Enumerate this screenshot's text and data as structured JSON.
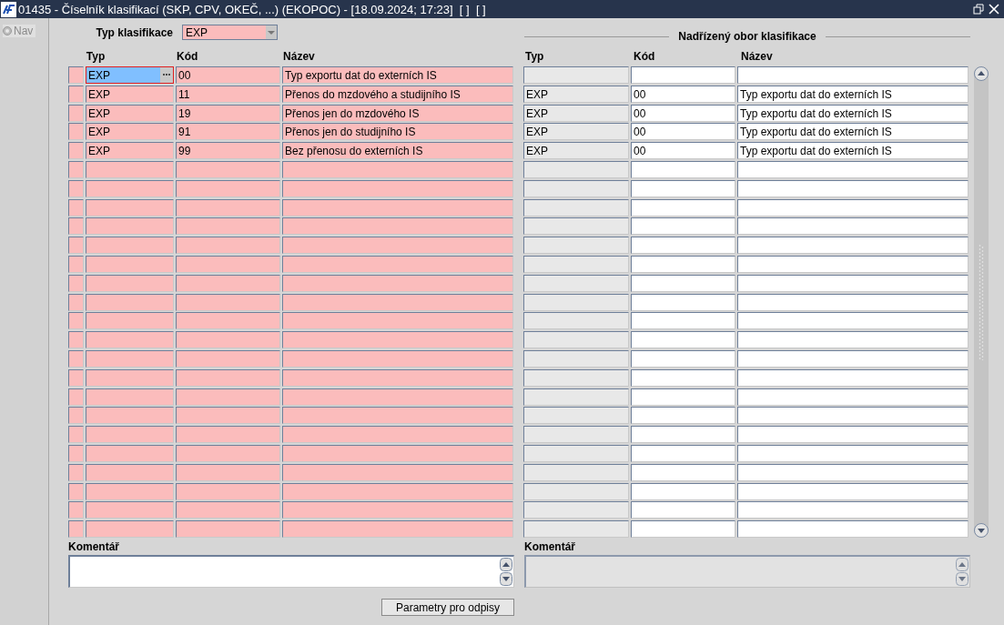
{
  "window": {
    "title": "01435 - Číselník klasifikací (SKP, CPV, OKEČ, ...) (EKOPOC) - [18.09.2024; 17:23]  [ ]  [ ]"
  },
  "nav": {
    "label": "Nav",
    "selected": false,
    "disabled": true
  },
  "filter": {
    "label": "Typ klasifikace",
    "value": "EXP"
  },
  "table": {
    "columns": [
      "Typ",
      "Kód",
      "Název"
    ],
    "rows": [
      {
        "typ": "EXP",
        "kod": "00",
        "nazev": "Typ exportu dat do externích IS",
        "selected": true
      },
      {
        "typ": "EXP",
        "kod": "11",
        "nazev": "Přenos do mzdového a studijního IS",
        "selected": false,
        "parent": {
          "typ": "EXP",
          "kod": "00",
          "nazev": "Typ exportu dat do externích IS"
        }
      },
      {
        "typ": "EXP",
        "kod": "19",
        "nazev": "Přenos jen do mzdového IS",
        "selected": false,
        "parent": {
          "typ": "EXP",
          "kod": "00",
          "nazev": "Typ exportu dat do externích IS"
        }
      },
      {
        "typ": "EXP",
        "kod": "91",
        "nazev": "Přenos jen do studijního IS",
        "selected": false,
        "parent": {
          "typ": "EXP",
          "kod": "00",
          "nazev": "Typ exportu dat do externích IS"
        }
      },
      {
        "typ": "EXP",
        "kod": "99",
        "nazev": "Bez přenosu do externích IS",
        "selected": false,
        "parent": {
          "typ": "EXP",
          "kod": "00",
          "nazev": "Typ exportu dat do externích IS"
        }
      }
    ]
  },
  "parent_table": {
    "title": "Nadřízený obor klasifikace",
    "columns": [
      "Typ",
      "Kód",
      "Název"
    ]
  },
  "comments": [
    {
      "label": "Komentář",
      "disabled": false
    },
    {
      "label": "Komentář",
      "disabled": true
    }
  ],
  "buttons": [
    "Parametry pro odpisy"
  ]
}
